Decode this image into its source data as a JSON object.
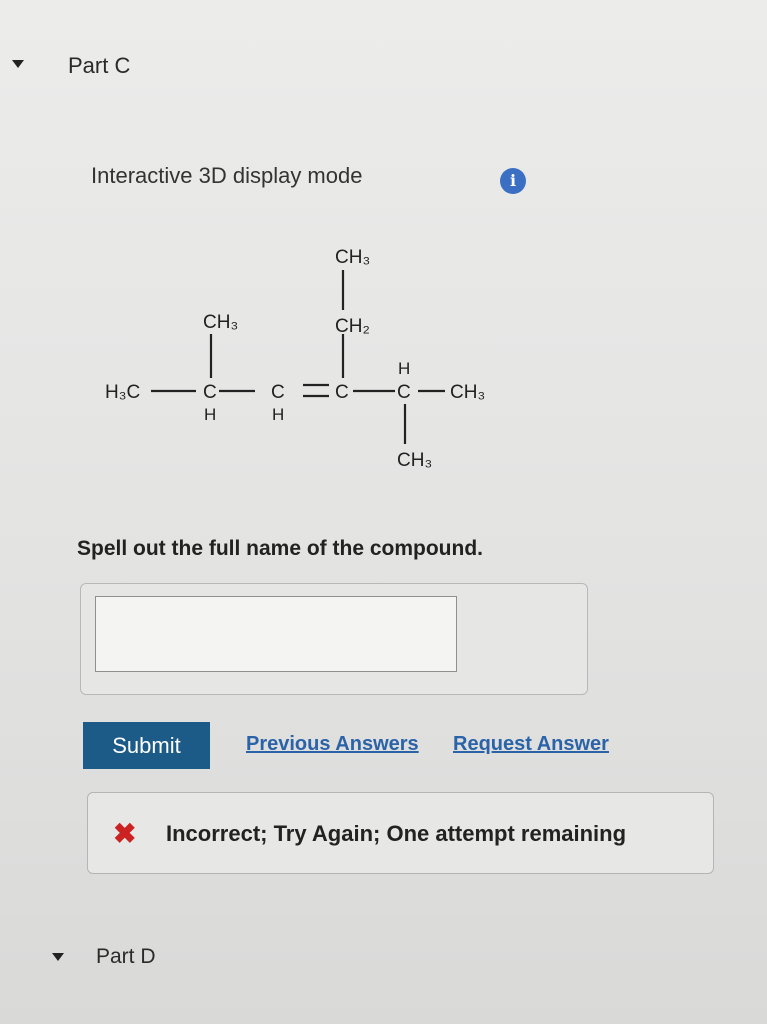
{
  "part_c": {
    "title": "Part C"
  },
  "display_mode": {
    "label": "Interactive 3D display mode",
    "info_glyph": "i",
    "info_icon": "info-circle-icon"
  },
  "molecule": {
    "labels": {
      "h3c": "H₃C",
      "ch3_top": "CH₃",
      "ch2": "CH₂",
      "ch3_left": "CH₃",
      "c1": "C",
      "c2": "C",
      "c3": "C",
      "c4": "C",
      "h_c1": "H",
      "h_c2": "H",
      "h_c4_top": "H",
      "ch3_right": "CH₃",
      "ch3_bottom": "CH₃"
    }
  },
  "question": {
    "prompt": "Spell out the full name of the compound."
  },
  "answer": {
    "value": "",
    "placeholder": ""
  },
  "actions": {
    "submit_label": "Submit",
    "previous_answers_label": "Previous Answers",
    "request_answer_label": "Request Answer"
  },
  "feedback": {
    "icon": "x-mark-icon",
    "glyph": "✖",
    "message": "Incorrect; Try Again; One attempt remaining",
    "color": "#cc2222"
  },
  "part_d": {
    "title": "Part D"
  },
  "colors": {
    "submit_bg": "#1c5b88",
    "link": "#2b63a8",
    "info_icon": "#3b6fc3"
  }
}
